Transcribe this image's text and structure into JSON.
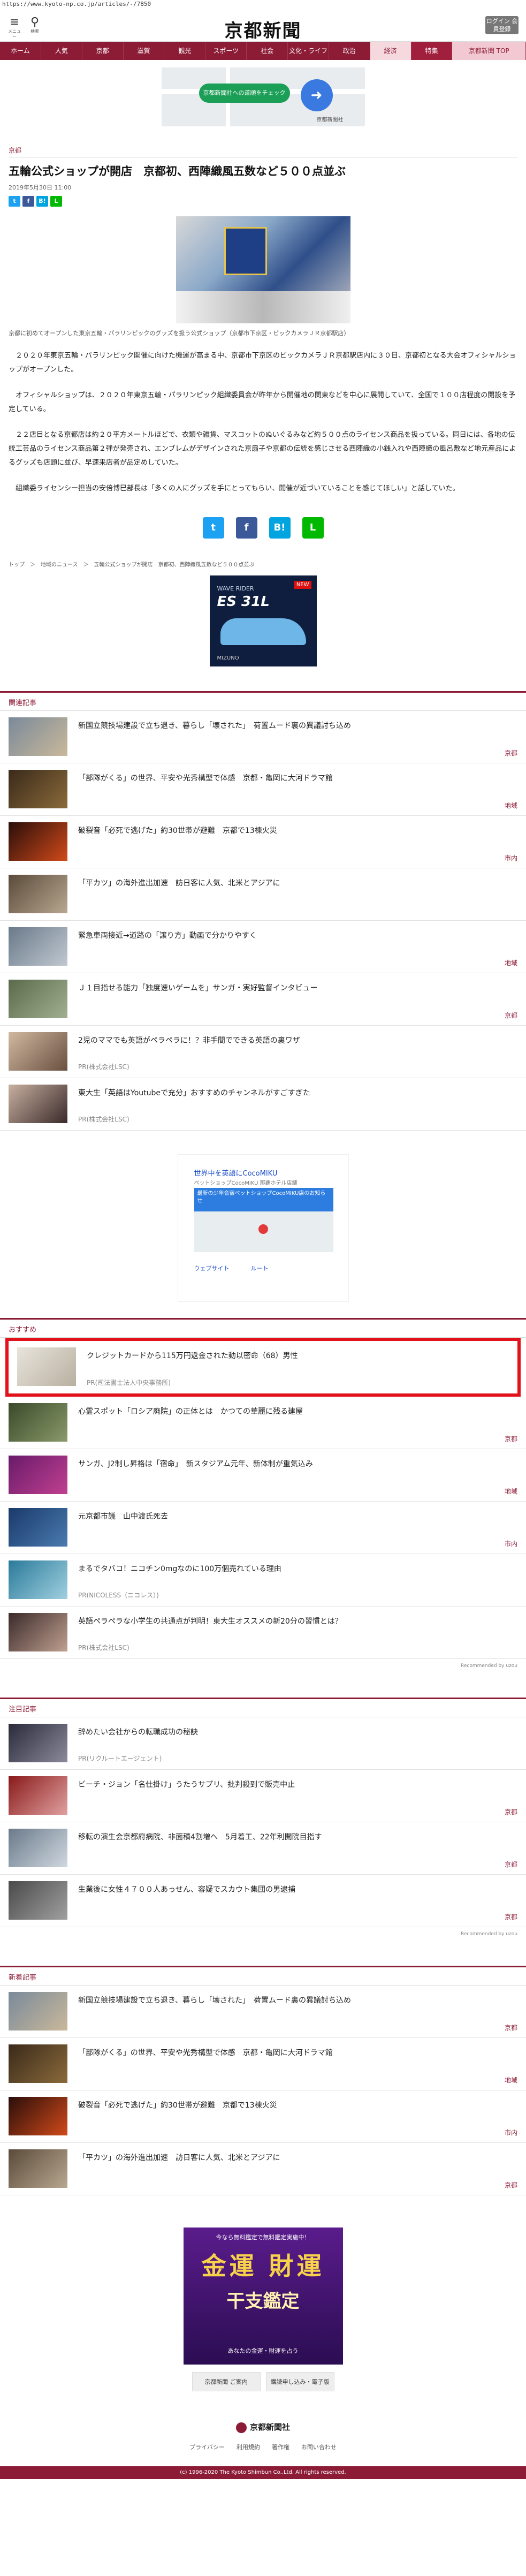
{
  "url": "https://www.kyoto-np.co.jp/articles/-/7850",
  "header": {
    "menu_label": "メニュー",
    "search_label": "検索",
    "logo": "京都新聞",
    "button_label": "ログイン 会員登録"
  },
  "nav": [
    "ホーム",
    "人気",
    "京都",
    "滋賀",
    "観光",
    "スポーツ",
    "社会",
    "文化・ライフ",
    "政治",
    "経済",
    "特集",
    "京都新聞 TOP"
  ],
  "top_ad": {
    "button": "京都新聞社への道順をチェック",
    "label": "京都新聞社"
  },
  "article": {
    "category": "京都",
    "title": "五輪公式ショップが開店　京都初、西陣織風五数など５００点並ぶ",
    "date": "2019年5月30日 11:00",
    "caption": "京都に初めてオープンした東京五輪・パラリンピックのグッズを扱う公式ショップ（京都市下京区・ビックカメラＪＲ京都駅店）",
    "paragraphs": [
      "２０２０年東京五輪・パラリンピック開催に向けた機運が高まる中、京都市下京区のビックカメラＪＲ京都駅店内に３０日、京都初となる大会オフィシャルショップがオープンした。",
      "オフィシャルショップは、２０２０年東京五輪・パラリンピック組織委員会が昨年から開催地の関東などを中心に展開していて、全国で１００店程度の開設を予定している。",
      "２２店目となる京都店は約２０平方メートルほどで、衣類や雑貨、マスコットのぬいぐるみなど約５００点のライセンス商品を扱っている。同日には、各地の伝統工芸品のライセンス商品第２弾が発売され、エンブレムがデザインされた京扇子や京都の伝統を感じさせる西陣織の小銭入れや西陣織の風呂敷など地元産品によるグッズも店頭に並び、早速来店者が品定めしていた。",
      "組織委ライセンシー担当の安倍博巳部長は「多くの人にグッズを手にとってもらい、開催が近づいていることを感じてほしい」と話していた。"
    ],
    "breadcrumb": "トップ　＞　地域のニュース　＞　五輪公式ショップが開店　京都初、西陣織風五数など５００点並ぶ"
  },
  "share": {
    "tw": "t",
    "fb": "f",
    "hb": "B!",
    "line": "L"
  },
  "shoe_ad": {
    "brand": "MIZUNO",
    "model": "ES 31L",
    "tag": "NEW",
    "sub": "WAVE RIDER"
  },
  "related": {
    "heading": "関連記事",
    "items": [
      {
        "title": "新国立競技場建設で立ち退き、暮らし「壊された」　荷置ムード裏の異議討ち込め",
        "tag": "京都"
      },
      {
        "title": "「部隊がくる」の世界、平安や光秀構型で体感　京都・亀岡に大河ドラマ館",
        "tag": "地域"
      },
      {
        "title": "破裂音「必死で逃げた」約30世帯が避難　京都で13棟火災",
        "tag": "市内"
      },
      {
        "title": "「平カツ」の海外進出加速　訪日客に人気、北米とアジアに",
        "tag": ""
      },
      {
        "title": "緊急車両接近→道路の「譲り方」動画で分かりやすく",
        "tag": "地域"
      },
      {
        "title": "Ｊ１目指せる能力「独度速いゲームを」サンガ・実好監督インタビュー",
        "tag": "京都"
      },
      {
        "title": "2児のママでも英語がペラペラに！？非手間でできる英語の裏ワザ",
        "sub": "PR(株式会社LSC)",
        "tag": ""
      },
      {
        "title": "東大生「英語はYoutubeで充分」おすすめのチャンネルがすごすぎた",
        "sub": "PR(株式会社LSC)",
        "tag": ""
      }
    ]
  },
  "google_ad": {
    "line1": "世界中を英語にCocoMIKU",
    "line2": "ペットショップCocoMIKU 那覇ホテル店舗",
    "blue": "最新の少年合宿ペットショップCocoMIKU店のお知らせ",
    "route": "ウェブサイト",
    "call": "ルート"
  },
  "recommend": {
    "heading": "おすすめ",
    "items": [
      {
        "title": "クレジットカードから115万円返金された動以密命（68）男性",
        "sub": "PR(司法書士法人中央事務所)",
        "tag": ""
      },
      {
        "title": "心霊スポット「ロシア廃院」の正体とは　かつての華麗に残る建屋",
        "tag": "京都"
      },
      {
        "title": "サンガ、J2制し昇格は「宿命」　新スタジアム元年、新体制が重気込み",
        "tag": "地域"
      },
      {
        "title": "元京都市議　山中渡氏死去",
        "tag": "市内"
      },
      {
        "title": "まるでタバコ！ニコチン0mgなのに100万個売れている理由",
        "sub": "PR(NICOLESS（ニコレス）)",
        "tag": ""
      },
      {
        "title": "英語ペラペラな小学生の共通点が判明！東大生オススメの新20分の習慣とは？",
        "sub": "PR(株式会社LSC)",
        "tag": ""
      }
    ],
    "credit": "Recommended by uzou"
  },
  "notice": {
    "heading": "注目記事",
    "items": [
      {
        "title": "辞めたい会社からの転職成功の秘訣",
        "sub": "PR(リクルートエージェント)",
        "tag": ""
      },
      {
        "title": "ビーチ・ジョン「名仕掛け」うたうサプリ、批判殺到で販売中止",
        "tag": "京都"
      },
      {
        "title": "移転の演生会京都府病院、非面積4割増へ　5月着工、22年利開院目指す",
        "tag": "京都"
      },
      {
        "title": "生業後に女性４７００人あっせん、容疑でスカウト集団の男逮捕",
        "tag": "京都"
      }
    ],
    "credit": "Recommended by uzou"
  },
  "newest": {
    "heading": "新着記事",
    "items": [
      {
        "title": "新国立競技場建設で立ち退き、暮らし「壊された」　荷置ムード裏の異議討ち込め",
        "tag": "京都"
      },
      {
        "title": "「部隊がくる」の世界、平安や光秀構型で体感　京都・亀岡に大河ドラマ館",
        "tag": "地域"
      },
      {
        "title": "破裂音「必死で逃げた」約30世帯が避難　京都で13棟火災",
        "tag": "市内"
      },
      {
        "title": "「平カツ」の海外進出加速　訪日客に人気、北米とアジアに",
        "tag": "京都"
      }
    ]
  },
  "fortune_ad": {
    "top": "今なら無料鑑定で無料鑑定実施中！",
    "line1": "金運 財運",
    "line2": "干支鑑定",
    "bottom": "あなたの金運・財運を占う"
  },
  "footer": {
    "buttons": [
      "京都新聞 ご案内",
      "購読申し込み・電子版"
    ],
    "logo": "京都新聞社",
    "links": [
      "プライバシー",
      "利用規約",
      "著作権",
      "お問い合わせ"
    ],
    "copyright": "(c) 1996-2020 The Kyoto Shimbun Co.,Ltd. All rights reserved."
  }
}
